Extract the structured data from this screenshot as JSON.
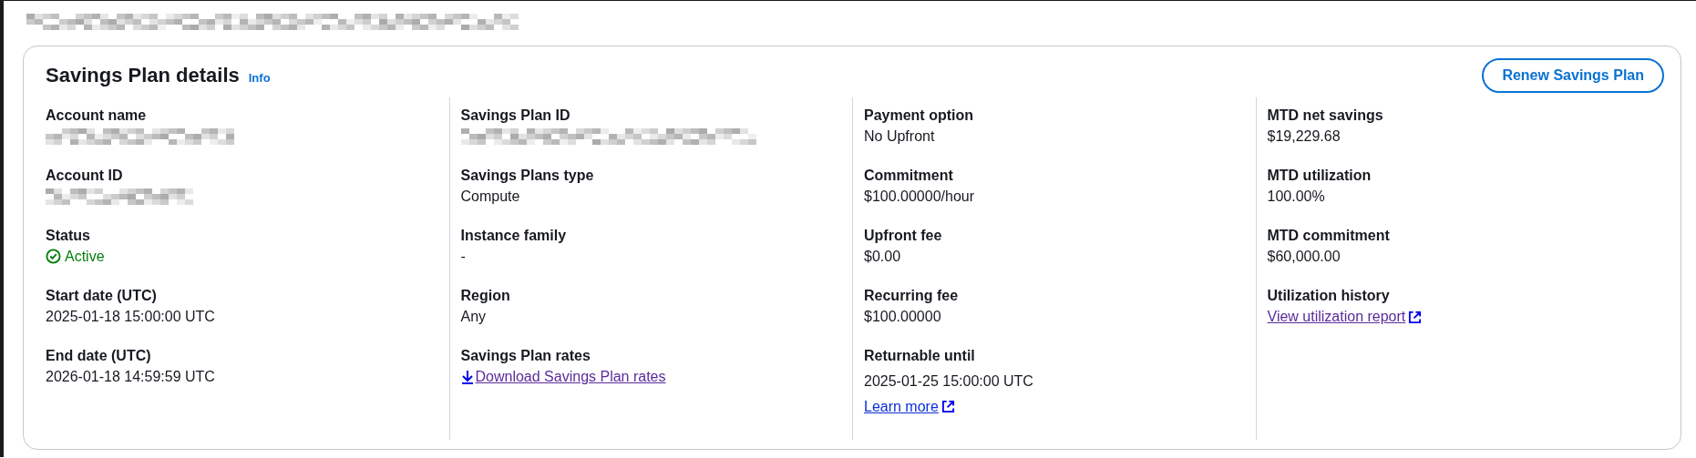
{
  "breadcrumb": {
    "kind": "redacted"
  },
  "panel": {
    "title": "Savings Plan details",
    "info_link": "Info",
    "button": "Renew Savings Plan",
    "columns": [
      {
        "fields": [
          {
            "label": "Account name",
            "kind": "redacted"
          },
          {
            "label": "Account ID",
            "kind": "redacted"
          },
          {
            "label": "Status",
            "kind": "status",
            "value": "Active"
          },
          {
            "label": "Start date (UTC)",
            "kind": "text",
            "value": "2025-01-18 15:00:00 UTC"
          },
          {
            "label": "End date (UTC)",
            "kind": "text",
            "value": "2026-01-18 14:59:59 UTC"
          }
        ]
      },
      {
        "fields": [
          {
            "label": "Savings Plan ID",
            "kind": "redacted"
          },
          {
            "label": "Savings Plans type",
            "kind": "text",
            "value": "Compute"
          },
          {
            "label": "Instance family",
            "kind": "text",
            "value": "-"
          },
          {
            "label": "Region",
            "kind": "text",
            "value": "Any"
          },
          {
            "label": "Savings Plan rates",
            "kind": "download-link",
            "value": "Download Savings Plan rates",
            "visited": true
          }
        ]
      },
      {
        "fields": [
          {
            "label": "Payment option",
            "kind": "text",
            "value": "No Upfront"
          },
          {
            "label": "Commitment",
            "kind": "text",
            "value": "$100.00000/hour"
          },
          {
            "label": "Upfront fee",
            "kind": "text",
            "value": "$0.00"
          },
          {
            "label": "Recurring fee",
            "kind": "text",
            "value": "$100.00000"
          },
          {
            "label": "Returnable until",
            "kind": "text",
            "value": "2025-01-25 15:00:00 UTC",
            "link": {
              "text": "Learn more",
              "kind": "external-link",
              "visited": false
            }
          }
        ]
      },
      {
        "fields": [
          {
            "label": "MTD net savings",
            "kind": "text",
            "value": "$19,229.68"
          },
          {
            "label": "MTD utilization",
            "kind": "text",
            "value": "100.00%"
          },
          {
            "label": "MTD commitment",
            "kind": "text",
            "value": "$60,000.00"
          },
          {
            "label": "Utilization history",
            "kind": "external-link",
            "value": "View utilization report",
            "visited": true
          }
        ]
      }
    ]
  }
}
